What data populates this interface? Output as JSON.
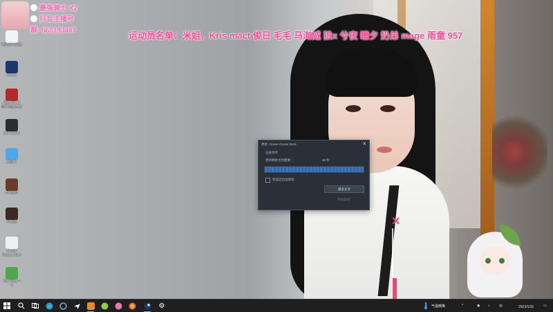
{
  "overlay": {
    "line1": "最强骑士 X2",
    "line2": "抖音主播号",
    "line3": "群: 663183467"
  },
  "roster": "运动员名单：米姐，Kris mact 俊日 毛毛 马海威 狼x 兮夜 瞳夕 奶弟 mage 雨童 957",
  "desktop_icons": [
    {
      "label": "新建文本文档",
      "color": "#f4f4f4"
    },
    {
      "label": "Steam",
      "color": "#1b3a6b"
    },
    {
      "label": "最新 SO 三\n国千里录已发",
      "color": "#b02a2a"
    },
    {
      "label": "Idle Dealer",
      "color": "#2c2c2c"
    },
    {
      "label": "糖豆人",
      "color": "#4fa7e8"
    },
    {
      "label": "卡牌战斗",
      "color": "#6a3b2a"
    },
    {
      "label": "小米游",
      "color": "#3a2a22"
    },
    {
      "label": "Goose\nGoose Duck",
      "color": "#f0f0f0"
    },
    {
      "label": "The Sims™\n4",
      "color": "#4da84a"
    }
  ],
  "dialog": {
    "title": "更新: Goose Goose Duck",
    "heading": "准备更新",
    "status_label": "更新剩余大约需要：",
    "status_value": "58 秒",
    "progress": 1.0,
    "checkbox_label": "完成后启动游戏",
    "primary_button": "最多允许",
    "secondary_button": "开始游戏"
  },
  "taskbar": {
    "tray_text": "气温微降",
    "language": "中",
    "time": "2023/1/31"
  }
}
